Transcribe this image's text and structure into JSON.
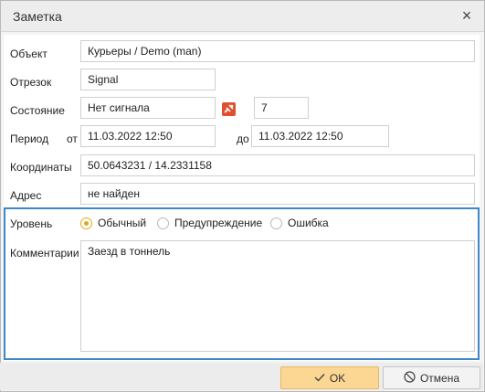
{
  "dialog": {
    "title": "Заметка"
  },
  "fields": {
    "object": {
      "label": "Объект",
      "value": "Курьеры / Demo (man)"
    },
    "segment": {
      "label": "Отрезок",
      "value": "Signal"
    },
    "state": {
      "label": "Состояние",
      "value": "Нет сигнала",
      "number": "7"
    },
    "period": {
      "label": "Период",
      "from_label": "от",
      "from": "11.03.2022 12:50",
      "to_label": "до",
      "to": "11.03.2022 12:50"
    },
    "coords": {
      "label": "Координаты",
      "value": "50.0643231 / 14.2331158"
    },
    "address": {
      "label": "Адрес",
      "value": "не найден"
    }
  },
  "level": {
    "label": "Уровень",
    "options": [
      {
        "label": "Обычный",
        "checked": true
      },
      {
        "label": "Предупреждение",
        "checked": false
      },
      {
        "label": "Ошибка",
        "checked": false
      }
    ]
  },
  "comment": {
    "label": "Комментарии",
    "value": "Заезд в тоннель"
  },
  "buttons": {
    "ok": "OK",
    "cancel": "Отмена"
  },
  "icons": {
    "close": "close-icon",
    "state": "no-signal-icon",
    "ok": "check-icon",
    "cancel": "cancel-icon"
  },
  "colors": {
    "accent": "#3e88c7",
    "ok_bg": "#fcd693",
    "radio_checked": "#e3a91a",
    "state_icon": "#e0502f"
  }
}
